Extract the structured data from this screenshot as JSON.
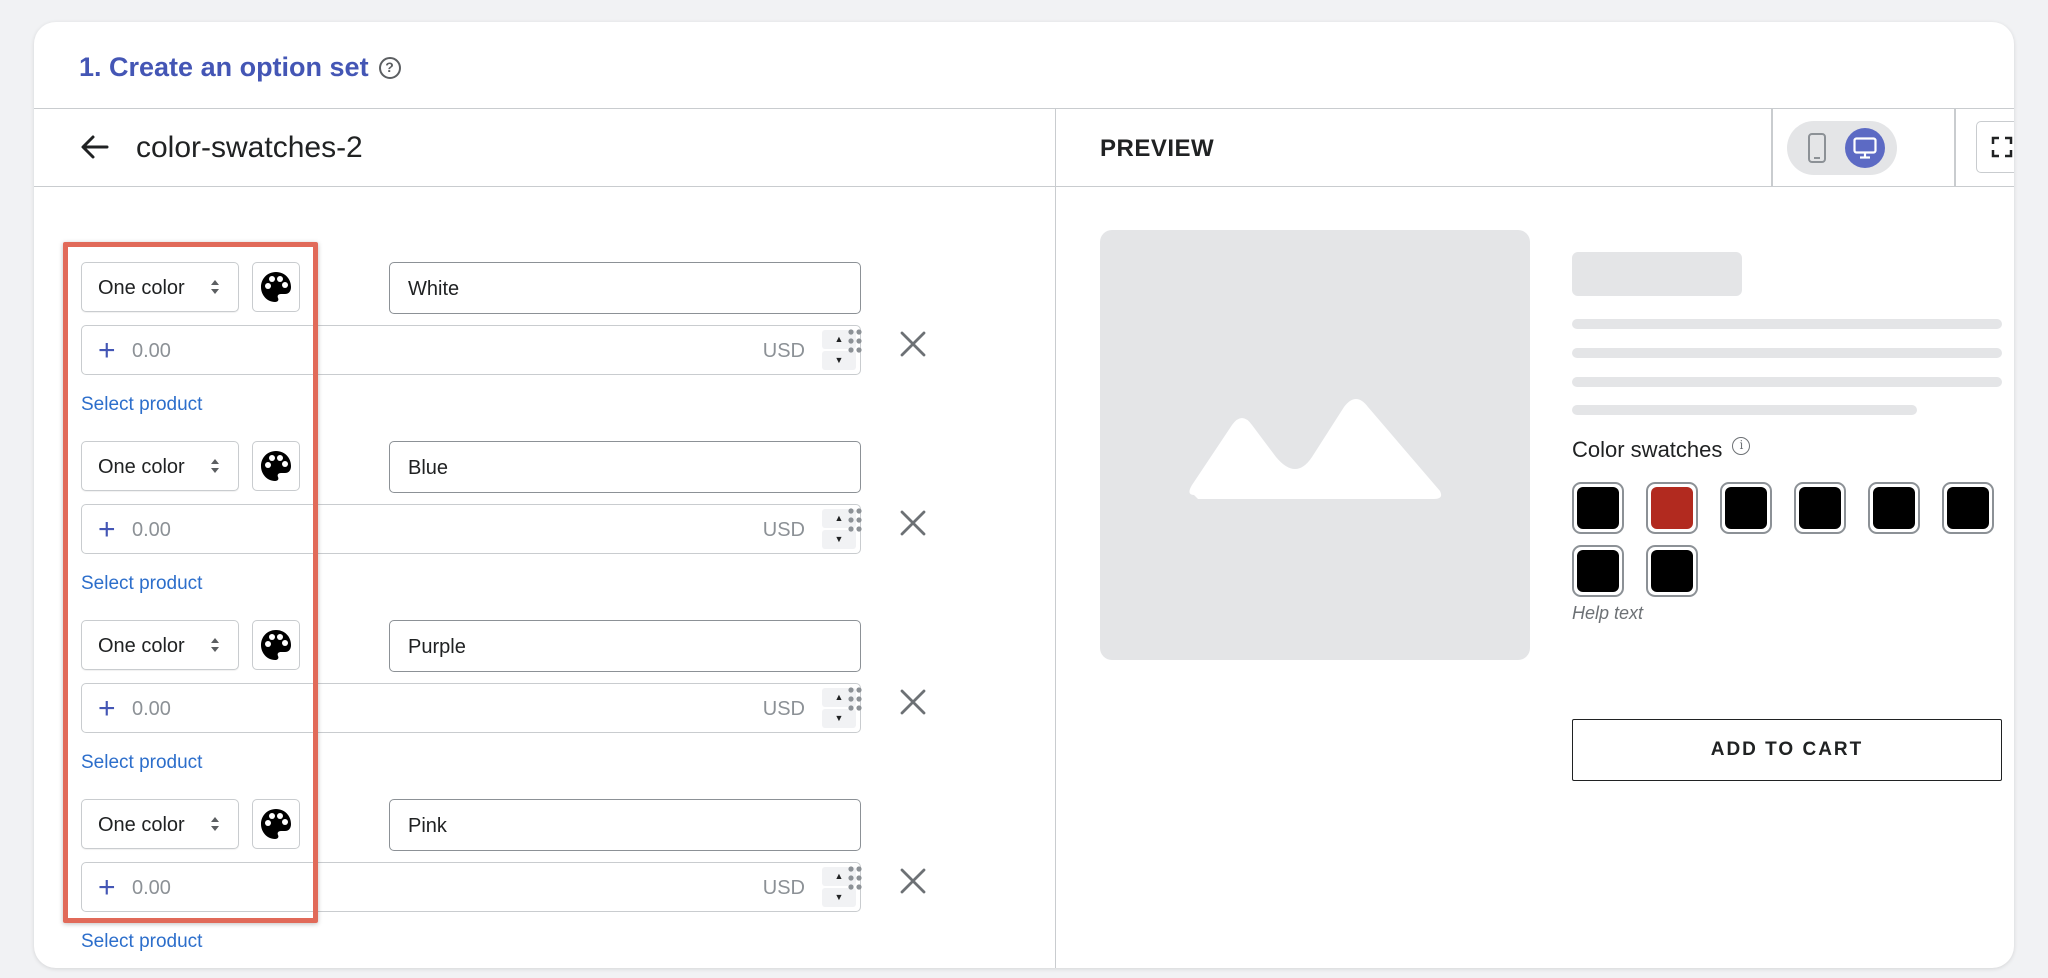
{
  "header": {
    "title": "1. Create an option set",
    "help_icon": "question-circle-icon"
  },
  "editor": {
    "set_name": "color-swatches-2",
    "options": [
      {
        "type": "One color",
        "name": "White",
        "price": "0.00",
        "currency": "USD",
        "select_product": "Select product"
      },
      {
        "type": "One color",
        "name": "Blue",
        "price": "0.00",
        "currency": "USD",
        "select_product": "Select product"
      },
      {
        "type": "One color",
        "name": "Purple",
        "price": "0.00",
        "currency": "USD",
        "select_product": "Select product"
      },
      {
        "type": "One color",
        "name": "Pink",
        "price": "0.00",
        "currency": "USD",
        "select_product": "Select product"
      }
    ]
  },
  "preview": {
    "title": "PREVIEW",
    "swatch_label": "Color swatches",
    "swatches": [
      {
        "color": "#000000"
      },
      {
        "color": "#b22a1f"
      },
      {
        "color": "#000000"
      },
      {
        "color": "#000000"
      },
      {
        "color": "#000000"
      },
      {
        "color": "#000000"
      },
      {
        "color": "#000000"
      },
      {
        "color": "#000000"
      }
    ],
    "help_text": "Help text",
    "add_to_cart": "ADD TO CART"
  },
  "colors": {
    "accent": "#4456b5",
    "link": "#2c6ecb",
    "highlight": "#e16a59",
    "toggle_active": "#5c6ac4"
  }
}
